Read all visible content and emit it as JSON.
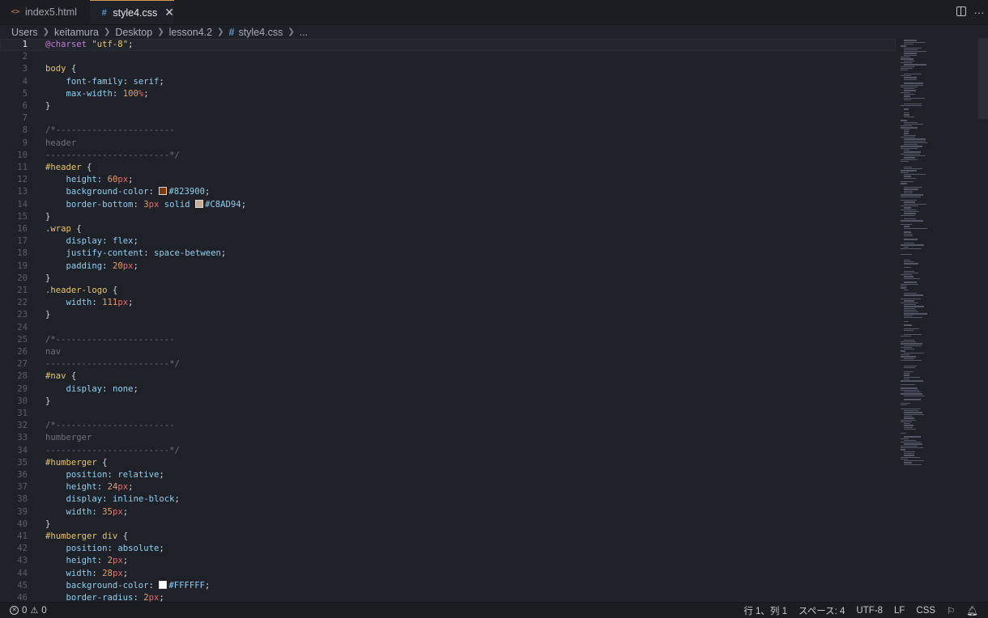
{
  "tabs": [
    {
      "label": "index5.html",
      "icon": "html-file-icon",
      "active": false
    },
    {
      "label": "style4.css",
      "icon": "css-file-icon",
      "active": true
    }
  ],
  "breadcrumb": [
    "Users",
    "keitamura",
    "Desktop",
    "lesson4.2",
    "style4.css",
    "..."
  ],
  "editor": {
    "lines": [
      {
        "n": "1"
      },
      {
        "n": "2"
      },
      {
        "n": "3"
      },
      {
        "n": "4"
      },
      {
        "n": "5"
      },
      {
        "n": "6"
      },
      {
        "n": "7"
      },
      {
        "n": "8"
      },
      {
        "n": "9"
      },
      {
        "n": "10"
      },
      {
        "n": "11"
      },
      {
        "n": "12"
      },
      {
        "n": "13"
      },
      {
        "n": "14"
      },
      {
        "n": "15"
      },
      {
        "n": "16"
      },
      {
        "n": "17"
      },
      {
        "n": "18"
      },
      {
        "n": "19"
      },
      {
        "n": "20"
      },
      {
        "n": "21"
      },
      {
        "n": "22"
      },
      {
        "n": "23"
      },
      {
        "n": "24"
      },
      {
        "n": "25"
      },
      {
        "n": "26"
      },
      {
        "n": "27"
      },
      {
        "n": "28"
      },
      {
        "n": "29"
      },
      {
        "n": "30"
      },
      {
        "n": "31"
      },
      {
        "n": "32"
      },
      {
        "n": "33"
      },
      {
        "n": "34"
      },
      {
        "n": "35"
      },
      {
        "n": "36"
      },
      {
        "n": "37"
      },
      {
        "n": "38"
      },
      {
        "n": "39"
      },
      {
        "n": "40"
      },
      {
        "n": "41"
      },
      {
        "n": "42"
      },
      {
        "n": "43"
      },
      {
        "n": "44"
      },
      {
        "n": "45"
      },
      {
        "n": "46"
      }
    ],
    "tokens": {
      "l1_at": "@charset",
      "l1_str": "\"utf-8\"",
      "l3_sel": "body",
      "l4_prop": "font-family",
      "l4_val": "serif",
      "l5_prop": "max-width",
      "l5_num": "100",
      "l5_unit": "%",
      "l8": "/*-----------------------",
      "l9": "header",
      "l10": "------------------------*/",
      "l11_sel": "#header",
      "l12_prop": "height",
      "l12_num": "60",
      "l12_unit": "px",
      "l13_prop": "background-color",
      "l13_val": "#823900",
      "l14_prop": "border-bottom",
      "l14_num": "3",
      "l14_unit": "px",
      "l14_kw": "solid",
      "l14_val": "#C8AD94",
      "l16_sel": ".wrap",
      "l17_prop": "display",
      "l17_val": "flex",
      "l18_prop": "justify-content",
      "l18_val": "space-between",
      "l19_prop": "padding",
      "l19_num": "20",
      "l19_unit": "px",
      "l21_sel": ".header-logo",
      "l22_prop": "width",
      "l22_num": "111",
      "l22_unit": "px",
      "l25": "/*-----------------------",
      "l26": "nav",
      "l27": "------------------------*/",
      "l28_sel": "#nav",
      "l29_prop": "display",
      "l29_val": "none",
      "l32": "/*-----------------------",
      "l33": "humberger",
      "l34": "------------------------*/",
      "l35_sel": "#humberger",
      "l36_prop": "position",
      "l36_val": "relative",
      "l37_prop": "height",
      "l37_num": "24",
      "l37_unit": "px",
      "l38_prop": "display",
      "l38_val": "inline-block",
      "l39_prop": "width",
      "l39_num": "35",
      "l39_unit": "px",
      "l41_sel": "#humberger",
      "l41_sel2": "div",
      "l42_prop": "position",
      "l42_val": "absolute",
      "l43_prop": "height",
      "l43_num": "2",
      "l43_unit": "px",
      "l44_prop": "width",
      "l44_num": "28",
      "l44_unit": "px",
      "l45_prop": "background-color",
      "l45_val": "#FFFFFF",
      "l46_prop": "border-radius",
      "l46_num": "2",
      "l46_unit": "px"
    }
  },
  "colors": {
    "swatch_823900": "#823900",
    "swatch_c8ad94": "#C8AD94",
    "swatch_ffffff": "#FFFFFF",
    "accent_tab": "#d39a4a"
  },
  "status": {
    "errors": "0",
    "warnings": "0",
    "position": "行 1、列 1",
    "spaces": "スペース: 4",
    "encoding": "UTF-8",
    "eol": "LF",
    "language": "CSS"
  }
}
